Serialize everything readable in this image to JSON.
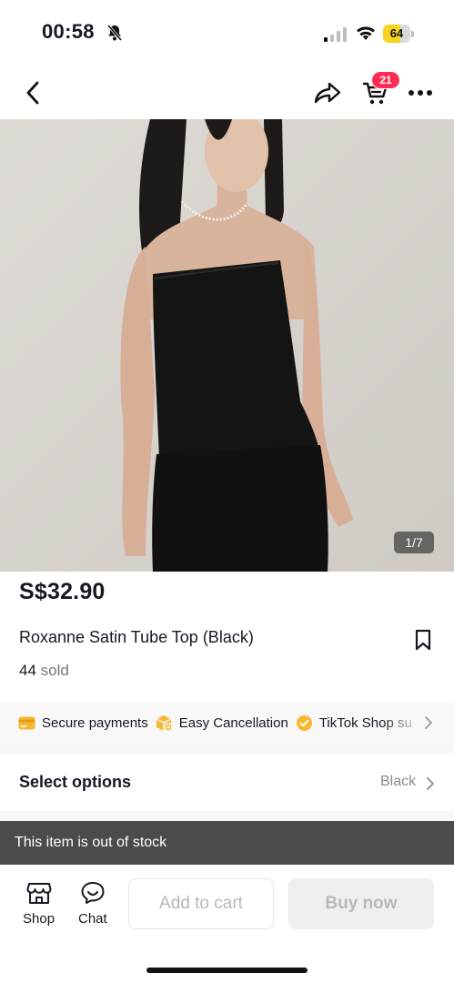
{
  "status_bar": {
    "time": "00:58",
    "battery": "64",
    "battery_level": 0.64,
    "silent_icon": "bell-slash-icon",
    "signal_icon": "cellular-signal-icon",
    "wifi_icon": "wifi-icon"
  },
  "nav": {
    "back_icon": "chevron-left-icon",
    "share_icon": "share-arrow-icon",
    "cart_icon": "cart-icon",
    "cart_badge": "21",
    "more_icon": "more-horizontal-icon"
  },
  "gallery": {
    "counter": "1/7"
  },
  "product": {
    "price": "S$32.90",
    "title": "Roxanne Satin Tube Top (Black)",
    "sold_count": "44",
    "sold_label": "sold"
  },
  "features": [
    {
      "icon": "card-icon",
      "label": "Secure payments"
    },
    {
      "icon": "box-return-icon",
      "label": "Easy Cancellation"
    },
    {
      "icon": "check-badge-icon",
      "label": "TikTok Shop su"
    }
  ],
  "options": {
    "label": "Select options",
    "value": "Black"
  },
  "out_of_stock": "This item is out of stock",
  "bottom_bar": {
    "shop_label": "Shop",
    "chat_label": "Chat",
    "add_to_cart": "Add to cart",
    "buy_now": "Buy now"
  },
  "colors": {
    "badge": "#fe2c55",
    "feature_icon": "#f5a623",
    "banner": "#4b4b4b",
    "disabled_text": "#b8b8b8"
  }
}
